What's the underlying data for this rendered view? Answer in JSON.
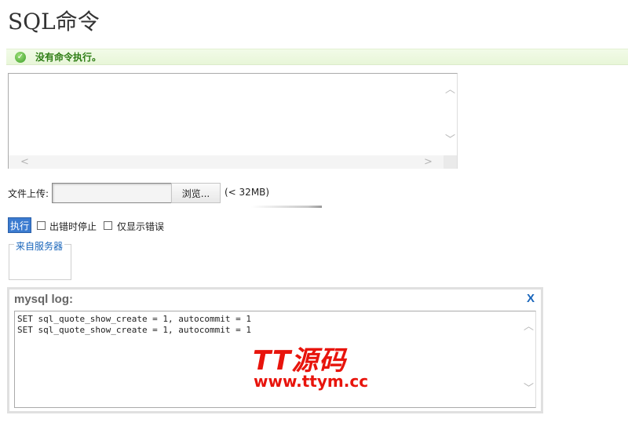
{
  "page": {
    "title": "SQL命令"
  },
  "status": {
    "message": "没有命令执行。",
    "icon": "check-circle-icon",
    "color": "#2e7d15"
  },
  "sql_editor": {
    "value": ""
  },
  "upload": {
    "label": "文件上传:",
    "browse_label": "浏览...",
    "size_limit": "(< 32MB)"
  },
  "actions": {
    "execute_label": "执行",
    "stop_on_error_label": "出错时停止",
    "stop_on_error_checked": false,
    "show_only_errors_label": "仅显示错误",
    "show_only_errors_checked": false
  },
  "server": {
    "legend": "来自服务器"
  },
  "log": {
    "title": "mysql log:",
    "close_label": "X",
    "lines": "SET sql_quote_show_create = 1, autocommit = 1\nSET sql_quote_show_create = 1, autocommit = 1"
  },
  "watermark": {
    "title": "TT源码",
    "url": "www.ttym.cc",
    "color": "#e8140c"
  },
  "colors": {
    "accent": "#3b7bd0",
    "link": "#1a66bb"
  }
}
